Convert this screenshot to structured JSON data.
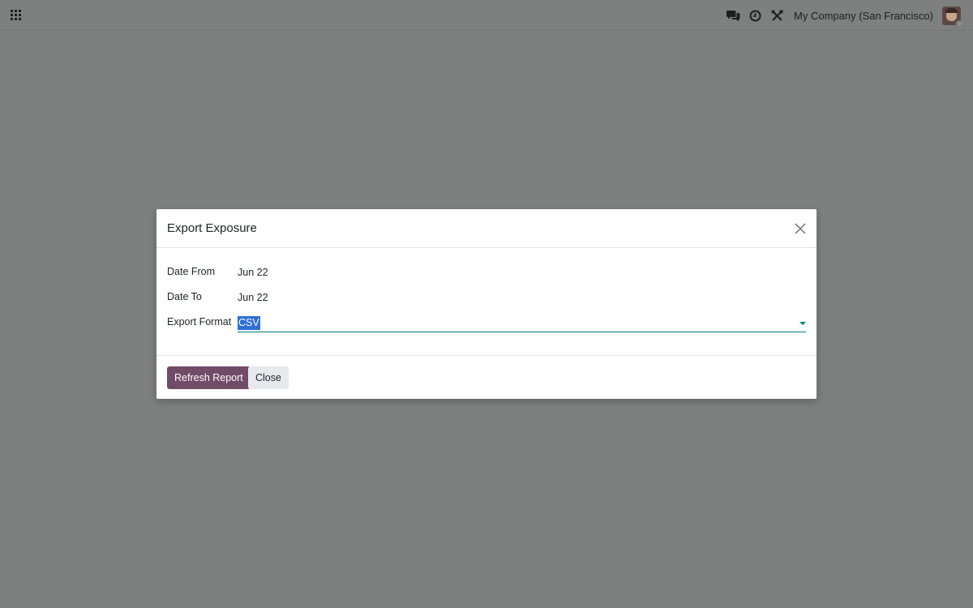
{
  "navbar": {
    "company": "My Company (San Francisco)",
    "icons": [
      "apps-icon",
      "chat-icon",
      "clock-icon",
      "tools-icon",
      "avatar"
    ]
  },
  "dialog": {
    "title": "Export Exposure",
    "fields": {
      "date_from": {
        "label": "Date From",
        "value": "Jun 22"
      },
      "date_to": {
        "label": "Date To",
        "value": "Jun 22"
      },
      "export_format": {
        "label": "Export Format",
        "value": "CSV"
      }
    },
    "buttons": {
      "refresh": "Refresh Report",
      "close": "Close"
    }
  },
  "colors": {
    "primary": "#714b67",
    "accent": "#017e84",
    "selection": "#2e6ed6",
    "backdrop": "#7e807f"
  }
}
